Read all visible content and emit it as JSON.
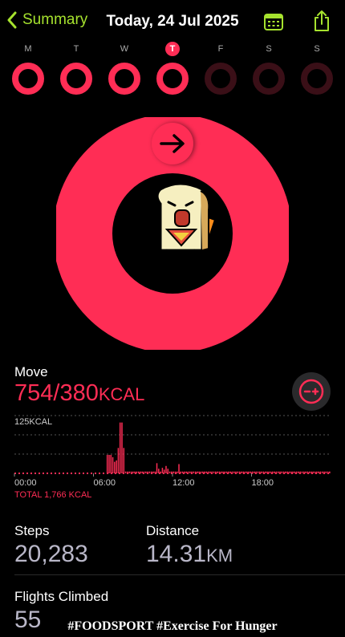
{
  "header": {
    "back_label": "Summary",
    "title": "Today, 24 Jul 2025",
    "accent": "#a6e22e"
  },
  "week": {
    "days": [
      {
        "label": "M",
        "active": true
      },
      {
        "label": "T",
        "active": true
      },
      {
        "label": "W",
        "active": true
      },
      {
        "label": "T",
        "active": true,
        "today": true
      },
      {
        "label": "F",
        "active": false
      },
      {
        "label": "S",
        "active": false
      },
      {
        "label": "S",
        "active": false
      }
    ]
  },
  "move": {
    "label": "Move",
    "value": "754/380",
    "unit": "KCAL",
    "progress": 1.98,
    "color": "#ff2d55"
  },
  "chart_data": {
    "type": "bar",
    "ylabel": "125KCAL",
    "x_ticks": [
      "00:00",
      "06:00",
      "12:00",
      "18:00"
    ],
    "total_label": "TOTAL 1,766 KCAL",
    "values": [
      0,
      0,
      0,
      0,
      0,
      0,
      0,
      0,
      0,
      0,
      0,
      0,
      0,
      0,
      0,
      0,
      0,
      0,
      0,
      0,
      0,
      0,
      0,
      0,
      0,
      0,
      0,
      0,
      0,
      0,
      0,
      0,
      0,
      0,
      0,
      0,
      0,
      0,
      0,
      0,
      0,
      0,
      0,
      0,
      0,
      0,
      0,
      0,
      0,
      0,
      40,
      40,
      40,
      35,
      25,
      28,
      55,
      110,
      110,
      55,
      4,
      4,
      4,
      4,
      4,
      4,
      4,
      4,
      4,
      4,
      4,
      4,
      4,
      4,
      4,
      4,
      4,
      22,
      10,
      4,
      12,
      8,
      16,
      10,
      4,
      4,
      4,
      4,
      4,
      20,
      4,
      4,
      4,
      4,
      4,
      4,
      4,
      4,
      4,
      4,
      4,
      4,
      4,
      4,
      4,
      4,
      4,
      4,
      4,
      4,
      4,
      4,
      4,
      4,
      4,
      4,
      4,
      4,
      4,
      4,
      4,
      4,
      4,
      4,
      4,
      4,
      4,
      4,
      4,
      4,
      4,
      4,
      4,
      4,
      4,
      4,
      4,
      4,
      4,
      4,
      4,
      4,
      4,
      4,
      4,
      4,
      4,
      4,
      4,
      4,
      4,
      4,
      4,
      4,
      4,
      4,
      4,
      4,
      4,
      4,
      4,
      4,
      4,
      4,
      4,
      4,
      4,
      4,
      4,
      4,
      4,
      4
    ],
    "ylim": [
      0,
      125
    ],
    "color": "#ff2d55"
  },
  "stats": {
    "steps_label": "Steps",
    "steps_value": "20,283",
    "distance_label": "Distance",
    "distance_value": "14.31",
    "distance_unit": "KM",
    "flights_label": "Flights Climbed",
    "flights_value": "55"
  },
  "footer": {
    "caption": "#FOODSPORT #Exercise For Hunger"
  }
}
